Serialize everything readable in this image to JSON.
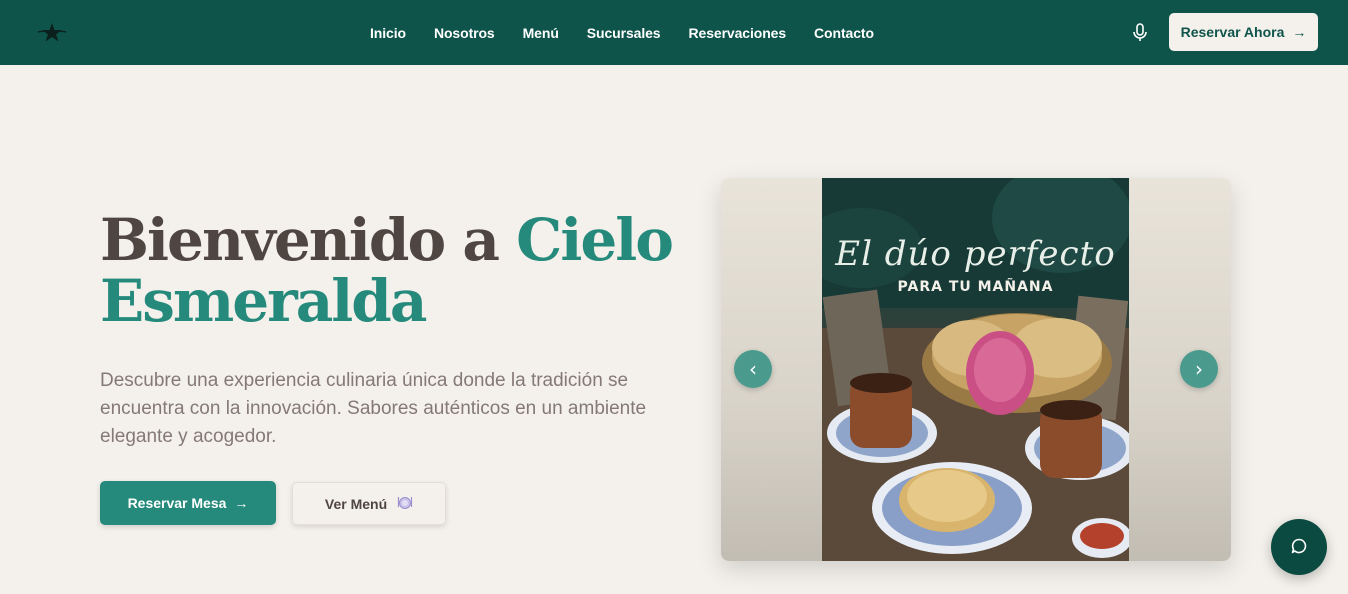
{
  "header": {
    "logo_icon": "star-logo-icon",
    "nav": [
      "Inicio",
      "Nosotros",
      "Menú",
      "Sucursales",
      "Reservaciones",
      "Contacto"
    ],
    "mic_icon": "microphone-icon",
    "cta_label": "Reservar Ahora",
    "cta_arrow": "→"
  },
  "hero": {
    "title_prefix": "Bienvenido a",
    "title_accent": "Cielo Esmeralda",
    "description": "Descubre una experiencia culinaria única donde la tradición se encuentra con la innovación. Sabores auténticos en un ambiente elegante y acogedor.",
    "primary_button": "Reservar Mesa",
    "primary_arrow": "→",
    "secondary_button": "Ver Menú",
    "secondary_icon": "plate-icon"
  },
  "carousel": {
    "slide_script": "El dúo perfecto",
    "slide_subtitle": "PARA TU MAÑANA",
    "prev_glyph": "‹",
    "next_glyph": "›"
  },
  "chat": {
    "icon": "chat-bubble-icon"
  },
  "colors": {
    "header_bg": "#0e544a",
    "accent": "#258a7b",
    "page_bg": "#f4f1ec",
    "title_dark": "#4f4541"
  }
}
